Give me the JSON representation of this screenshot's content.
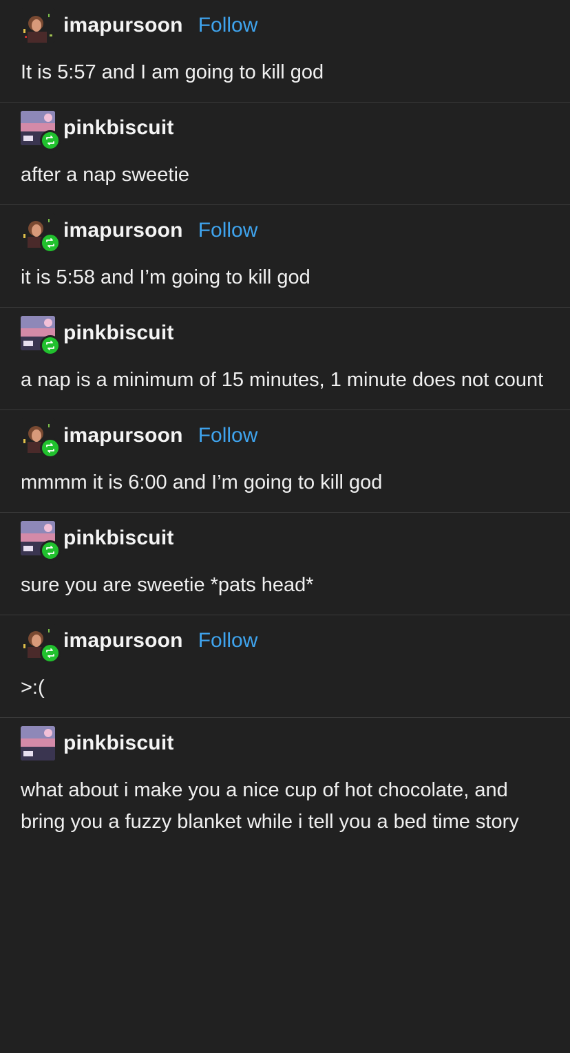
{
  "posts": [
    {
      "username": "imapursoon",
      "follow_label": "Follow",
      "text": "It is 5:57 and I am going to kill god",
      "is_reblog": false,
      "avatar": "portrait-avatar"
    },
    {
      "username": "pinkbiscuit",
      "follow_label": "",
      "text": "after a nap sweetie",
      "is_reblog": true,
      "avatar": "landscape-avatar"
    },
    {
      "username": "imapursoon",
      "follow_label": "Follow",
      "text": "it is 5:58 and I’m going to kill god",
      "is_reblog": true,
      "avatar": "portrait-avatar"
    },
    {
      "username": "pinkbiscuit",
      "follow_label": "",
      "text": "a nap is a minimum of 15 minutes, 1 minute does not count",
      "is_reblog": true,
      "avatar": "landscape-avatar"
    },
    {
      "username": "imapursoon",
      "follow_label": "Follow",
      "text": "mmmm it is 6:00 and I’m going to kill god",
      "is_reblog": true,
      "avatar": "portrait-avatar"
    },
    {
      "username": "pinkbiscuit",
      "follow_label": "",
      "text": "sure you are sweetie *pats head*",
      "is_reblog": true,
      "avatar": "landscape-avatar"
    },
    {
      "username": "imapursoon",
      "follow_label": "Follow",
      "text": ">:(",
      "is_reblog": true,
      "avatar": "portrait-avatar"
    },
    {
      "username": "pinkbiscuit",
      "follow_label": "",
      "text": "what about i make you a nice cup of hot chocolate, and bring you a fuzzy blanket while i tell you a bed time story",
      "is_reblog": false,
      "avatar": "landscape-avatar"
    }
  ],
  "colors": {
    "background": "#212121",
    "text": "#f0f0f0",
    "follow": "#3fa4ee",
    "reblog_badge": "#21c12e",
    "divider": "#3a3a3a"
  },
  "icons": {
    "reblog": "reblog-icon"
  }
}
